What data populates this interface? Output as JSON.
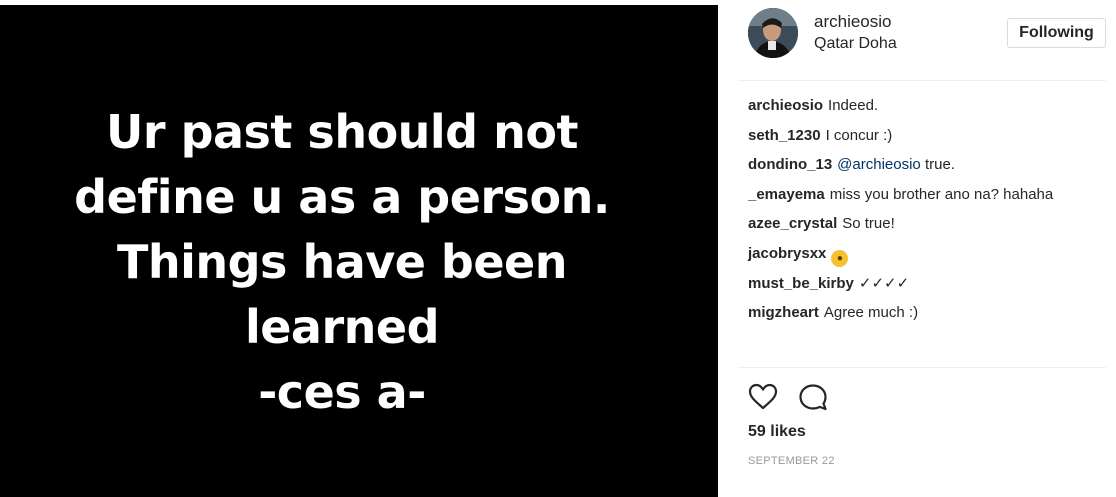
{
  "post": {
    "quote_lines": [
      "Ur past should not",
      "define u as a person.",
      "Things have been",
      "learned",
      "-ces a-"
    ]
  },
  "header": {
    "username": "archieosio",
    "location": "Qatar Doha",
    "follow_label": "Following"
  },
  "comments": [
    {
      "user": "archieosio",
      "text": "Indeed."
    },
    {
      "user": "seth_1230",
      "text": "I concur :)"
    },
    {
      "user": "dondino_13",
      "mention": "@archieosio",
      "text": " true."
    },
    {
      "user": "_emayema",
      "text": "miss you brother ano na? hahaha"
    },
    {
      "user": "azee_crystal",
      "text": "So true!"
    },
    {
      "user": "jacobrysxx",
      "emoji": "scream-emoji"
    },
    {
      "user": "must_be_kirby",
      "text": "✓✓✓✓"
    },
    {
      "user": "migzheart",
      "text": "Agree much :)"
    }
  ],
  "actions": {
    "likes": "59 likes",
    "date": "SEPTEMBER 22"
  },
  "colors": {
    "image_bg": "#000000",
    "text": "#262626",
    "mention": "#003569",
    "muted": "#999999",
    "border": "#dbdbdb"
  }
}
